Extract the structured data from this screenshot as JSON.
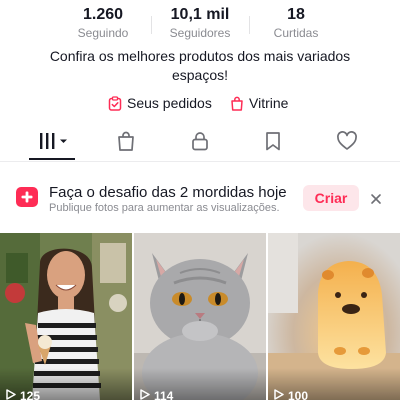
{
  "profile": {
    "stats": [
      {
        "value": "1.260",
        "label": "Seguindo"
      },
      {
        "value": "10,1 mil",
        "label": "Seguidores"
      },
      {
        "value": "18",
        "label": "Curtidas"
      }
    ],
    "bio": "Confira os melhores produtos dos mais variados espaços!",
    "links": {
      "orders": "Seus pedidos",
      "showcase": "Vitrine"
    }
  },
  "tabs": [
    {
      "icon": "videos-grid-icon",
      "selected": true
    },
    {
      "icon": "shopping-bag-icon",
      "selected": false
    },
    {
      "icon": "lock-icon",
      "selected": false
    },
    {
      "icon": "bookmark-icon",
      "selected": false
    },
    {
      "icon": "heart-icon",
      "selected": false
    }
  ],
  "challenge": {
    "title": "Faça o desafio das 2 mordidas hoje",
    "subtitle": "Publique fotos para aumentar as visualizações.",
    "button": "Criar"
  },
  "videos": [
    {
      "views": "125",
      "subject": "woman-with-ice-cream"
    },
    {
      "views": "114",
      "subject": "grey-cat"
    },
    {
      "views": "100",
      "subject": "capybara-lamp"
    }
  ],
  "colors": {
    "accent": "#fe2c55",
    "accent_soft": "#fde6ea",
    "text": "#161823",
    "muted": "#8a8b91"
  }
}
